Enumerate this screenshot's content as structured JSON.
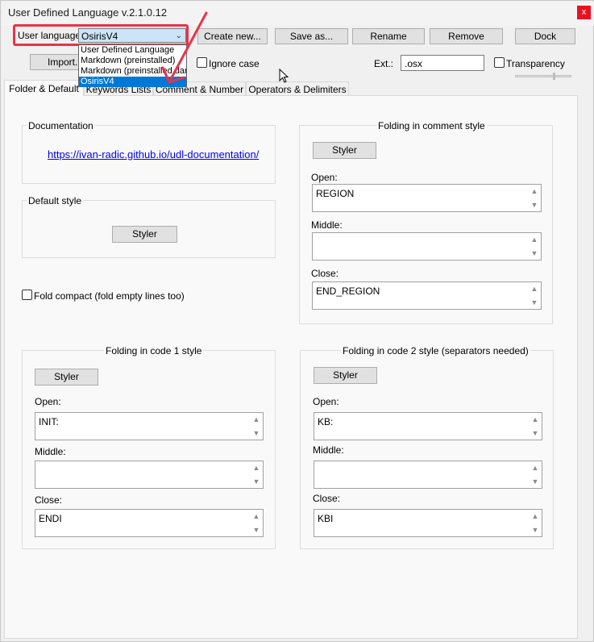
{
  "window": {
    "title": "User Defined Language v.2.1.0.12",
    "close_label": "x"
  },
  "toolbar": {
    "user_language_label": "User language:",
    "selected_language": "OsirisV4",
    "language_options": [
      "User Defined Language",
      "Markdown (preinstalled)",
      "Markdown (preinstalled dark)",
      "OsirisV4"
    ],
    "create_new": "Create new...",
    "save_as": "Save as...",
    "rename": "Rename",
    "remove": "Remove",
    "dock": "Dock",
    "import": "Import...",
    "ignore_case": "Ignore case",
    "ext_label": "Ext.:",
    "ext_value": ".osx",
    "transparency": "Transparency"
  },
  "tabs": [
    "Folder & Default",
    "Keywords Lists",
    "Comment & Number",
    "Operators & Delimiters"
  ],
  "documentation": {
    "title": "Documentation",
    "link": "https://ivan-radic.github.io/udl-documentation/"
  },
  "default_style": {
    "title": "Default style",
    "styler": "Styler"
  },
  "fold_compact": "Fold compact (fold empty lines too)",
  "comment_fold": {
    "title": "Folding in comment style",
    "styler": "Styler",
    "open_label": "Open:",
    "open_value": "REGION",
    "middle_label": "Middle:",
    "middle_value": "",
    "close_label": "Close:",
    "close_value": "END_REGION"
  },
  "code1_fold": {
    "title": "Folding in code 1 style",
    "styler": "Styler",
    "open_label": "Open:",
    "open_value": "INIT:",
    "middle_label": "Middle:",
    "middle_value": "",
    "close_label": "Close:",
    "close_value": "ENDI"
  },
  "code2_fold": {
    "title": "Folding in code 2 style (separators needed)",
    "styler": "Styler",
    "open_label": "Open:",
    "open_value": "KB:",
    "middle_label": "Middle:",
    "middle_value": "",
    "close_label": "Close:",
    "close_value": "KBI"
  },
  "colors": {
    "annotation": "#e8334a",
    "selection": "#0078d7",
    "link": "#0000ee"
  }
}
